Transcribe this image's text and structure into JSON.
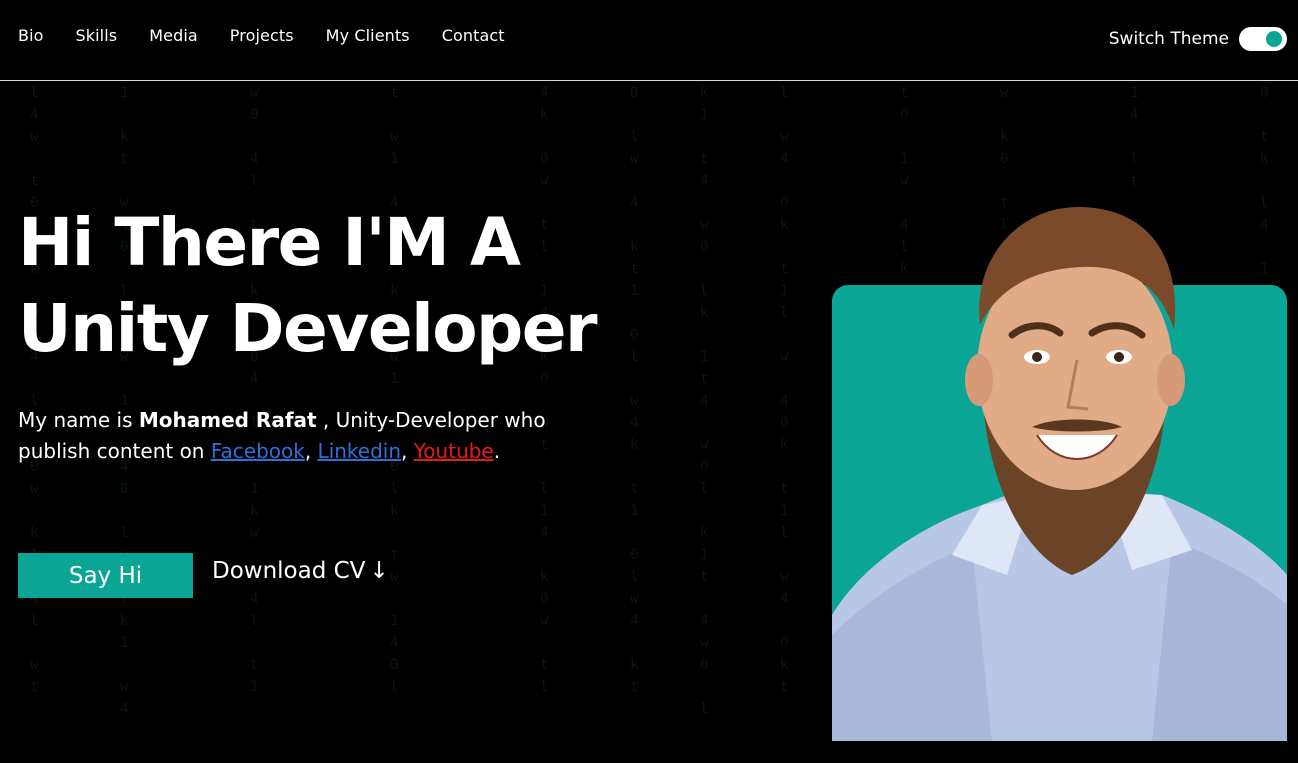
{
  "nav": {
    "links": [
      "Bio",
      "Skills",
      "Media",
      "Projects",
      "My Clients",
      "Contact"
    ],
    "theme_label": "Switch Theme",
    "theme_on": true
  },
  "hero": {
    "headline_line1": "Hi There I'M A",
    "headline_line2": "Unity Developer",
    "intro_prefix": "My name is ",
    "name": "Mohamed Rafat",
    "intro_mid": " , Unity-Developer who publish content on ",
    "facebook": "Facebook",
    "comma1": ", ",
    "linkedin": "Linkedin",
    "comma2": ", ",
    "youtube": "Youtube",
    "period": ".",
    "say_hi": "Say Hi",
    "download_cv": "Download CV",
    "download_arrow": "↓"
  },
  "colors": {
    "accent": "#0aa594",
    "facebook": "#2f6fd8",
    "linkedin": "#2f6fd8",
    "youtube": "#e51b1b",
    "background": "#000000"
  },
  "icons": {
    "theme_toggle": "toggle-switch-icon",
    "download": "arrow-down-icon"
  }
}
